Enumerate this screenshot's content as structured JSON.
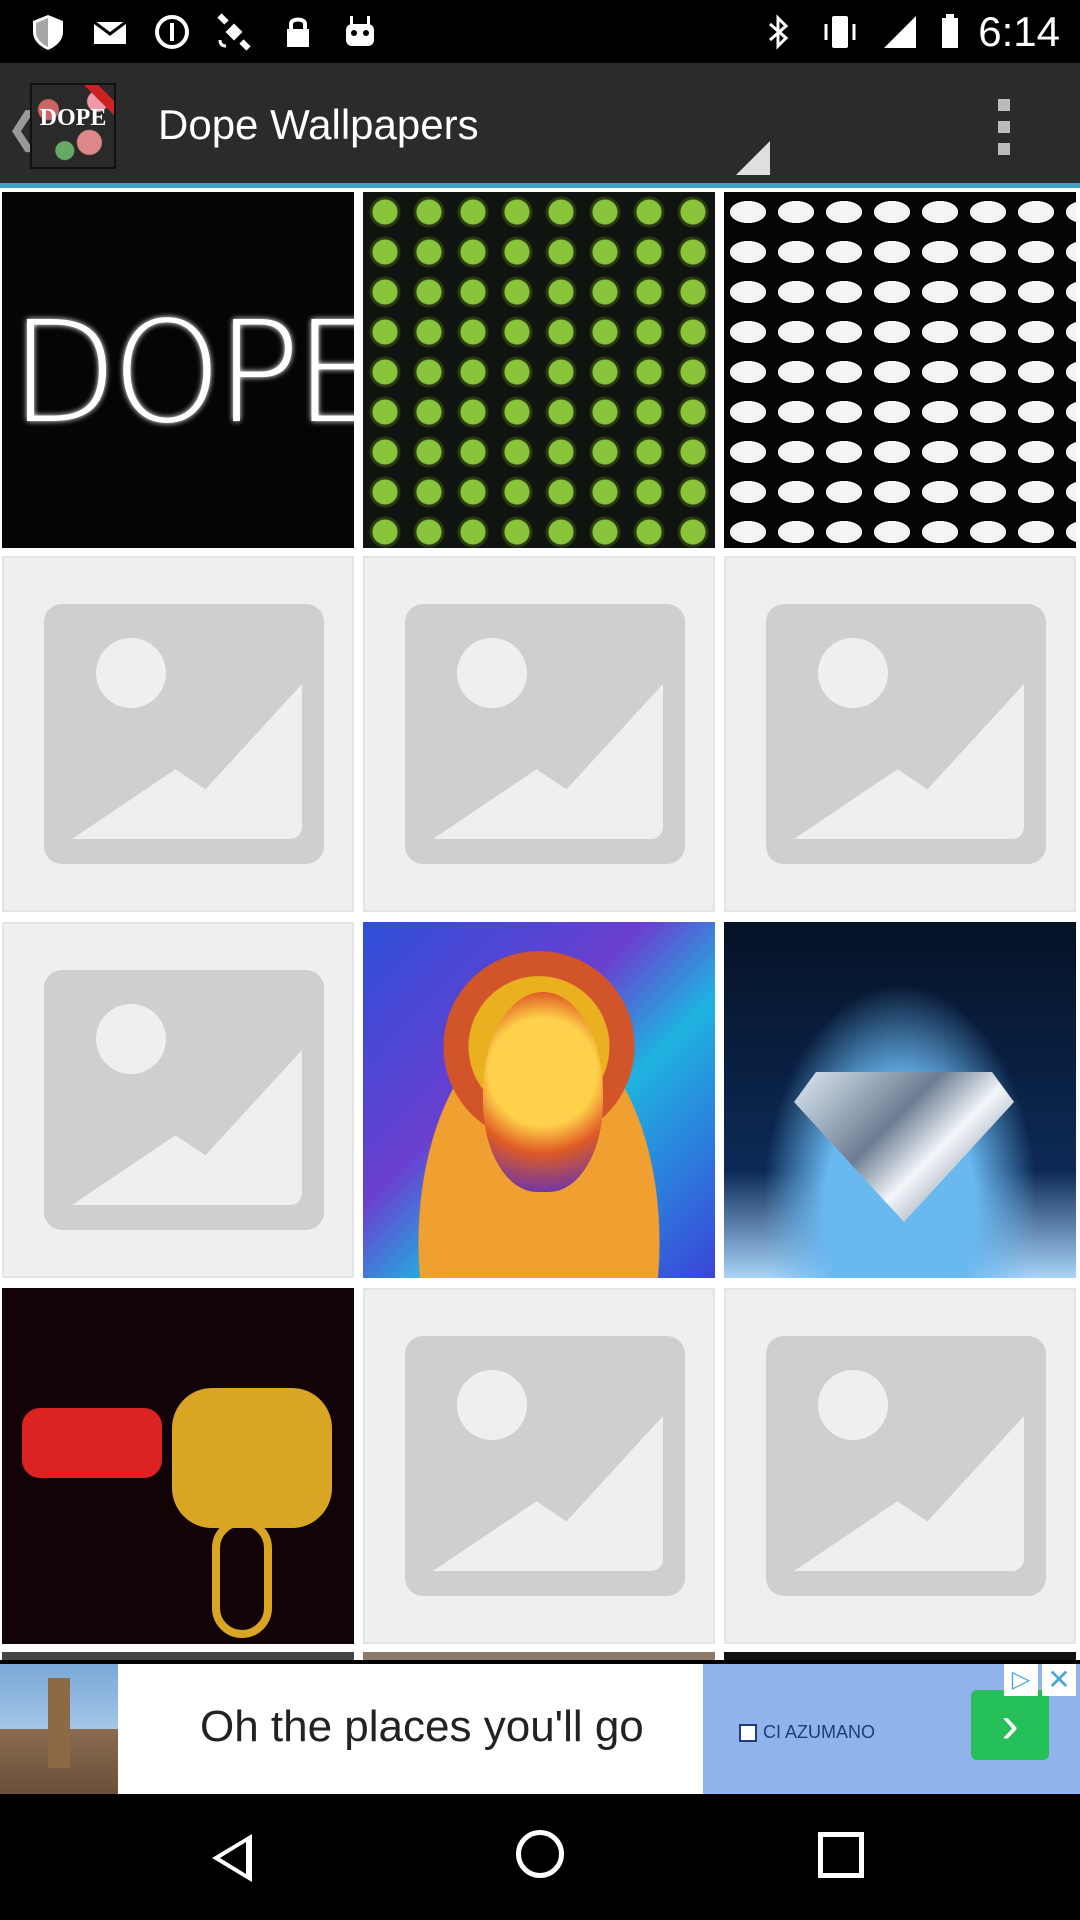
{
  "status_bar": {
    "time": "6:14",
    "left_icons": [
      "shield-icon",
      "mail-icon",
      "info-icon",
      "satellite-icon",
      "lock-icon",
      "android-icon"
    ],
    "right_icons": [
      "bluetooth-icon",
      "vibrate-icon",
      "signal-icon",
      "battery-icon"
    ]
  },
  "action_bar": {
    "title": "Dope Wallpapers",
    "app_icon_text": "DOPE"
  },
  "grid": {
    "tiles": [
      {
        "type": "image",
        "name": "dope-neon"
      },
      {
        "type": "image",
        "name": "green-money-pattern"
      },
      {
        "type": "image",
        "name": "white-fists-pattern"
      },
      {
        "type": "placeholder"
      },
      {
        "type": "placeholder"
      },
      {
        "type": "placeholder"
      },
      {
        "type": "placeholder"
      },
      {
        "type": "image",
        "name": "colorful-portrait"
      },
      {
        "type": "image",
        "name": "diamond"
      },
      {
        "type": "image",
        "name": "gauntlet-chain"
      },
      {
        "type": "placeholder"
      },
      {
        "type": "placeholder"
      }
    ]
  },
  "ad": {
    "text": "Oh the places you'll go",
    "brand": "CI AZUMANO",
    "colors": {
      "go_button": "#25c05a",
      "right_panel": "#8fb3ea"
    }
  },
  "nav_bar": {
    "buttons": [
      "back",
      "home",
      "recents"
    ]
  },
  "colors": {
    "action_bar": "#2b2b2b",
    "accent_line": "#3fa3c8"
  }
}
